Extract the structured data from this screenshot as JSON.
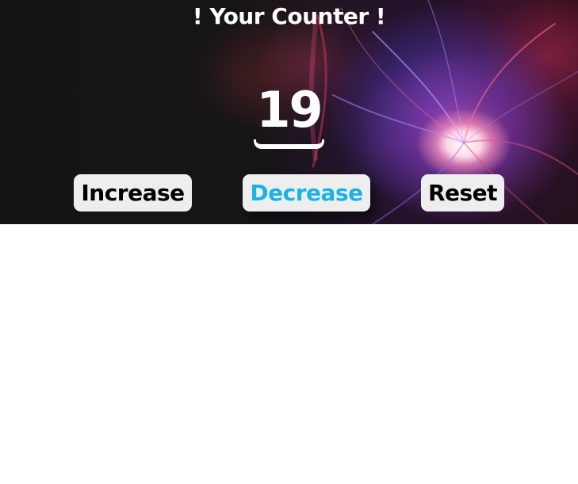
{
  "counter": {
    "title": "! Your Counter !",
    "value": "19"
  },
  "buttons": {
    "increase_label": "Increase",
    "decrease_label": "Decrease",
    "reset_label": "Reset"
  },
  "colors": {
    "button_background": "#eeeeee",
    "button_text": "#000000",
    "active_button_text": "#1ab3e8",
    "title_text": "#ffffff",
    "page_background": "#ffffff"
  }
}
